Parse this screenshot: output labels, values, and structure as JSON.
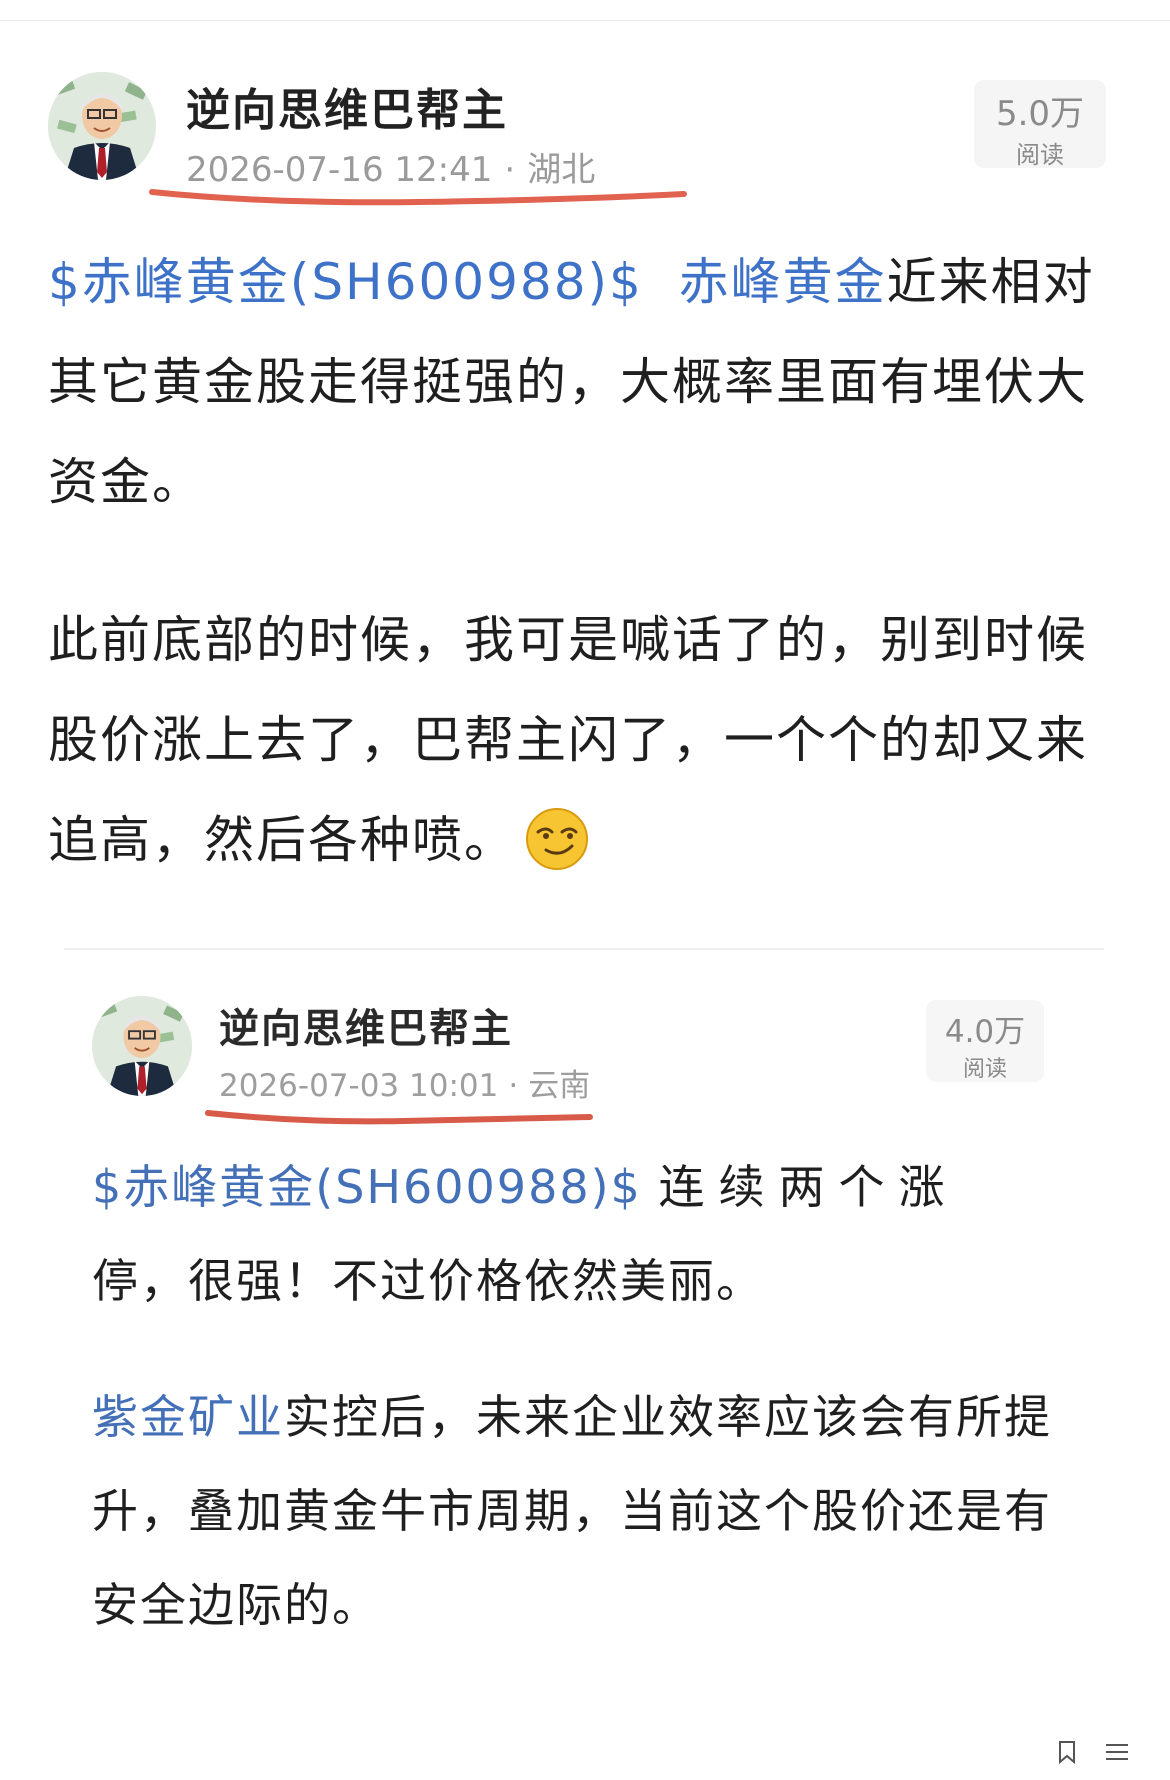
{
  "post": {
    "author": "逆向思维巴帮主",
    "date": "2026-07-16 12:41",
    "separator": "·",
    "location": "湖北",
    "reads": "5.0万",
    "reads_label": "阅读",
    "para1": {
      "stock_tag": "$赤峰黄金(SH600988)$",
      "stock_link": "赤峰黄金",
      "text": "近来相对其它黄金股走得挺强的，大概率里面有埋伏大资金。"
    },
    "para2": {
      "text": "此前底部的时候，我可是喊话了的，别到时候股价涨上去了，巴帮主闪了，一个个的却又来追高，然后各种喷。",
      "emoji": "smirk-emoji"
    }
  },
  "quoted_post": {
    "author": "逆向思维巴帮主",
    "date": "2026-07-03 10:01",
    "separator": "·",
    "location": "云南",
    "reads": "4.0万",
    "reads_label": "阅读",
    "para1": {
      "stock_tag": "$赤峰黄金(SH600988)$",
      "text_spaced": "连续两个涨",
      "text": "停，很强！不过价格依然美丽。"
    },
    "para2": {
      "stock_link": "紫金矿业",
      "text": "实控后，未来企业效率应该会有所提升，叠加黄金牛市周期，当前这个股价还是有安全边际的。"
    }
  },
  "colors": {
    "link": "#3d72c8",
    "underline_mark": "#e0624f",
    "meta": "#9a9a9a"
  },
  "icons": [
    "avatar",
    "smirk-emoji",
    "bookmark-icon",
    "menu-icon"
  ]
}
